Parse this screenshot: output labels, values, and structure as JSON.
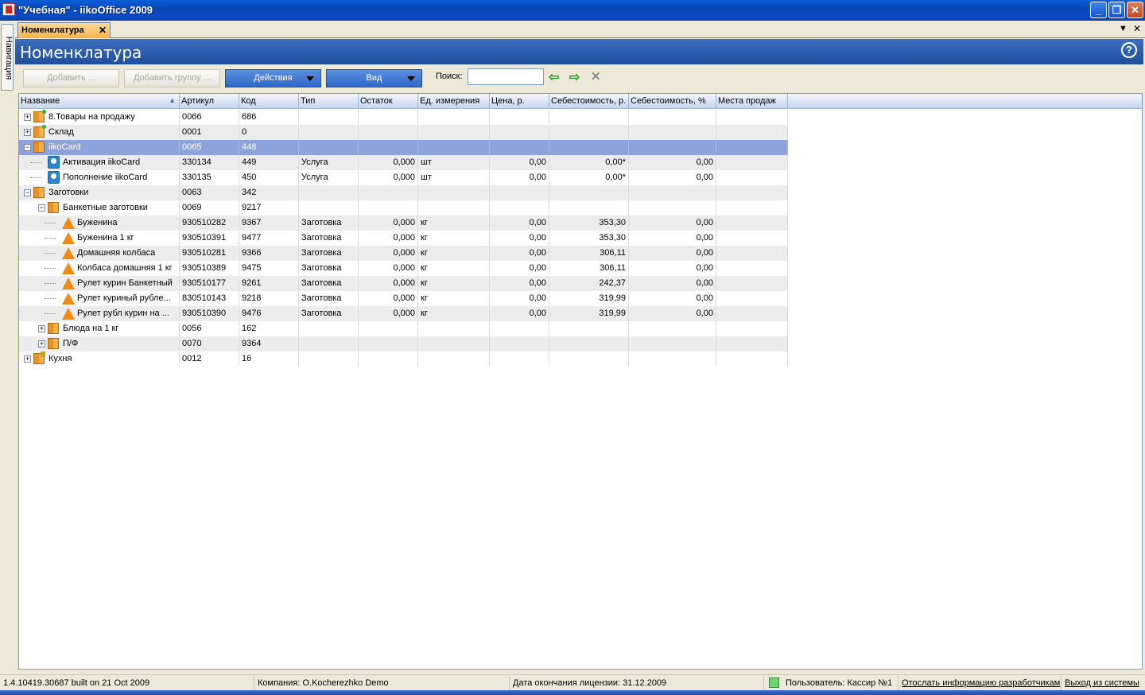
{
  "window": {
    "title": "\"Учебная\" - iikoOffice 2009",
    "minimize_glyph": "_",
    "restore_glyph": "❐",
    "close_glyph": "✕"
  },
  "nav": {
    "label": "Навигация"
  },
  "doc_tab": {
    "label": "Номенклатура",
    "close_glyph": "✕",
    "menu_glyph": "▼",
    "close_all_glyph": "✕"
  },
  "panel": {
    "title": "Номенклатура",
    "help_glyph": "?"
  },
  "toolbar": {
    "add_label": "Добавить ...",
    "add_group_label": "Добавить группу ...",
    "actions_label": "Действия",
    "view_label": "Вид",
    "search_label": "Поиск:",
    "search_value": "",
    "back_glyph": "⇦",
    "forward_glyph": "⇨",
    "clear_glyph": "✕"
  },
  "grid": {
    "columns": [
      "Название",
      "Артикул",
      "Код",
      "Тип",
      "Остаток",
      "Ед. измерения",
      "Цена, р.",
      "Себестоимость, р.",
      "Себестоимость, %",
      "Места продаж"
    ],
    "sort_glyph": "▲",
    "rows": [
      {
        "name": "8.Товары на продажу",
        "article": "0066",
        "code": "686",
        "type": "",
        "stock": "",
        "unit": "",
        "price": "",
        "cost": "",
        "cost_pct": "",
        "places": ""
      },
      {
        "name": "Склад",
        "article": "0001",
        "code": "0",
        "type": "",
        "stock": "",
        "unit": "",
        "price": "",
        "cost": "",
        "cost_pct": "",
        "places": ""
      },
      {
        "name": "iikoCard",
        "article": "0065",
        "code": "448",
        "type": "",
        "stock": "",
        "unit": "",
        "price": "",
        "cost": "",
        "cost_pct": "",
        "places": ""
      },
      {
        "name": "Активация iikoCard",
        "article": "330134",
        "code": "449",
        "type": "Услуга",
        "stock": "0,000",
        "unit": "шт",
        "price": "0,00",
        "cost": "0,00*",
        "cost_pct": "0,00",
        "places": ""
      },
      {
        "name": "Пополнение iikoCard",
        "article": "330135",
        "code": "450",
        "type": "Услуга",
        "stock": "0,000",
        "unit": "шт",
        "price": "0,00",
        "cost": "0,00*",
        "cost_pct": "0,00",
        "places": ""
      },
      {
        "name": "Заготовки",
        "article": "0063",
        "code": "342",
        "type": "",
        "stock": "",
        "unit": "",
        "price": "",
        "cost": "",
        "cost_pct": "",
        "places": ""
      },
      {
        "name": "Банкетные заготовки",
        "article": "0069",
        "code": "9217",
        "type": "",
        "stock": "",
        "unit": "",
        "price": "",
        "cost": "",
        "cost_pct": "",
        "places": ""
      },
      {
        "name": "Буженина",
        "article": "930510282",
        "code": "9367",
        "type": "Заготовка",
        "stock": "0,000",
        "unit": "кг",
        "price": "0,00",
        "cost": "353,30",
        "cost_pct": "0,00",
        "places": ""
      },
      {
        "name": "Буженина 1 кг",
        "article": "930510391",
        "code": "9477",
        "type": "Заготовка",
        "stock": "0,000",
        "unit": "кг",
        "price": "0,00",
        "cost": "353,30",
        "cost_pct": "0,00",
        "places": ""
      },
      {
        "name": "Домашняя колбаса",
        "article": "930510281",
        "code": "9366",
        "type": "Заготовка",
        "stock": "0,000",
        "unit": "кг",
        "price": "0,00",
        "cost": "306,11",
        "cost_pct": "0,00",
        "places": ""
      },
      {
        "name": "Колбаса домашняя 1 кг",
        "article": "930510389",
        "code": "9475",
        "type": "Заготовка",
        "stock": "0,000",
        "unit": "кг",
        "price": "0,00",
        "cost": "306,11",
        "cost_pct": "0,00",
        "places": ""
      },
      {
        "name": "Рулет курин Банкетный",
        "article": "930510177",
        "code": "9261",
        "type": "Заготовка",
        "stock": "0,000",
        "unit": "кг",
        "price": "0,00",
        "cost": "242,37",
        "cost_pct": "0,00",
        "places": ""
      },
      {
        "name": "Рулет куриный рубле...",
        "article": "830510143",
        "code": "9218",
        "type": "Заготовка",
        "stock": "0,000",
        "unit": "кг",
        "price": "0,00",
        "cost": "319,99",
        "cost_pct": "0,00",
        "places": ""
      },
      {
        "name": "Рулет рубл курин на ...",
        "article": "930510390",
        "code": "9476",
        "type": "Заготовка",
        "stock": "0,000",
        "unit": "кг",
        "price": "0,00",
        "cost": "319,99",
        "cost_pct": "0,00",
        "places": ""
      },
      {
        "name": "Блюда на 1 кг",
        "article": "0056",
        "code": "162",
        "type": "",
        "stock": "",
        "unit": "",
        "price": "",
        "cost": "",
        "cost_pct": "",
        "places": ""
      },
      {
        "name": "П/Ф",
        "article": "0070",
        "code": "9364",
        "type": "",
        "stock": "",
        "unit": "",
        "price": "",
        "cost": "",
        "cost_pct": "",
        "places": ""
      },
      {
        "name": "Кухня",
        "article": "0012",
        "code": "16",
        "type": "",
        "stock": "",
        "unit": "",
        "price": "",
        "cost": "",
        "cost_pct": "",
        "places": ""
      }
    ]
  },
  "status": {
    "build": "1.4.10419.30687 built on 21 Oct 2009",
    "company": "Компания: O.Kocherezhko Demo",
    "license": "Дата окончания лицензии: 31.12.2009",
    "user": "Пользователь: Кассир №1",
    "feedback_link": "Отослать информацию разработчикам",
    "logout_link": "Выход из системы"
  },
  "colors": {
    "selection": "#8ea2dc",
    "header_blue": "#1e4e9c",
    "tab_orange": "#f4b54a"
  }
}
